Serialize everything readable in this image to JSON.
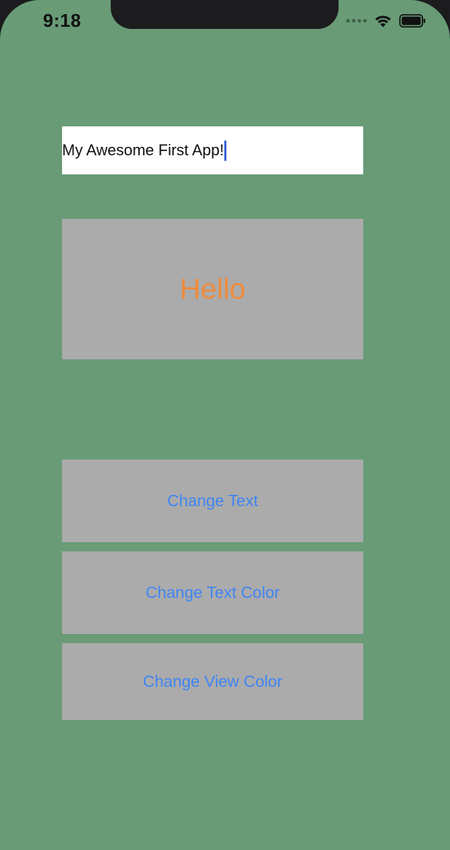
{
  "status_bar": {
    "time": "9:18"
  },
  "text_field": {
    "value": "My Awesome First App!"
  },
  "label": {
    "text": "Hello",
    "color": "#ef8b3c"
  },
  "buttons": {
    "change_text": "Change Text",
    "change_text_color": "Change Text Color",
    "change_view_color": "Change View Color"
  },
  "colors": {
    "view_background": "#689b76",
    "box_background": "#ababab",
    "button_tint": "#3f85f4",
    "caret": "#3a63d6"
  },
  "icons": [
    "signal-dots-icon",
    "wifi-icon",
    "battery-icon"
  ]
}
